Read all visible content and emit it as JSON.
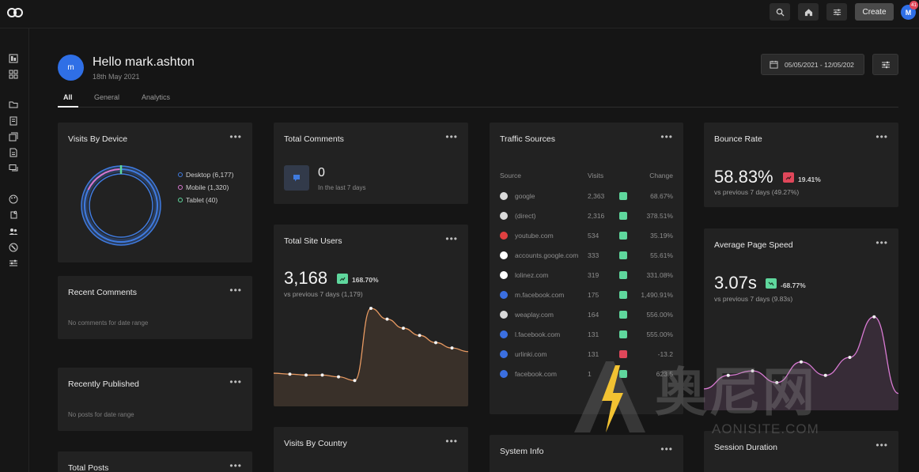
{
  "topbar": {
    "create_label": "Create",
    "avatar_initial": "M",
    "notification_count": "41"
  },
  "header": {
    "avatar_initial": "m",
    "greeting": "Hello mark.ashton",
    "date": "18th May 2021",
    "date_range": "05/05/2021 - 12/05/202"
  },
  "tabs": [
    {
      "label": "All",
      "active": true
    },
    {
      "label": "General",
      "active": false
    },
    {
      "label": "Analytics",
      "active": false
    }
  ],
  "visits_by_device": {
    "title": "Visits By Device",
    "legend": [
      {
        "label": "Desktop (6,177)",
        "color": "#3f7be0"
      },
      {
        "label": "Mobile (1,320)",
        "color": "#d977d0"
      },
      {
        "label": "Tablet (40)",
        "color": "#5fd79d"
      }
    ]
  },
  "recent_comments": {
    "title": "Recent Comments",
    "empty": "No comments for date range"
  },
  "recently_published": {
    "title": "Recently Published",
    "empty": "No posts for date range"
  },
  "total_posts": {
    "title": "Total Posts"
  },
  "total_comments": {
    "title": "Total Comments",
    "value": "0",
    "sub": "In the last 7 days"
  },
  "total_site_users": {
    "title": "Total Site Users",
    "value": "3,168",
    "change": "168.70%",
    "sub": "vs previous 7 days (1,179)",
    "line_color": "#e89a62",
    "series": [
      0.28,
      0.27,
      0.26,
      0.26,
      0.24,
      0.2,
      1.0,
      0.88,
      0.78,
      0.7,
      0.62,
      0.56,
      0.52
    ]
  },
  "visits_by_country": {
    "title": "Visits By Country"
  },
  "traffic_sources": {
    "title": "Traffic Sources",
    "headers": {
      "source": "Source",
      "visits": "Visits",
      "change": "Change"
    },
    "rows": [
      {
        "source": "google",
        "visits": "2,363",
        "change": "68.67%",
        "icon_color": "#d9d9d9",
        "up": true
      },
      {
        "source": "(direct)",
        "visits": "2,316",
        "change": "378.51%",
        "icon_color": "#d9d9d9",
        "up": true
      },
      {
        "source": "youtube.com",
        "visits": "534",
        "change": "35.19%",
        "icon_color": "#e04040",
        "up": true
      },
      {
        "source": "accounts.google.com",
        "visits": "333",
        "change": "55.61%",
        "icon_color": "#ffffff",
        "up": true
      },
      {
        "source": "lolinez.com",
        "visits": "319",
        "change": "331.08%",
        "icon_color": "#ffffff",
        "up": true
      },
      {
        "source": "m.facebook.com",
        "visits": "175",
        "change": "1,490.91%",
        "icon_color": "#3b6fe0",
        "up": true
      },
      {
        "source": "weaplay.com",
        "visits": "164",
        "change": "556.00%",
        "icon_color": "#d9d9d9",
        "up": true
      },
      {
        "source": "l.facebook.com",
        "visits": "131",
        "change": "555.00%",
        "icon_color": "#3b6fe0",
        "up": true
      },
      {
        "source": "urlinki.com",
        "visits": "131",
        "change": "-13.2",
        "icon_color": "#3b6fe0",
        "up": false
      },
      {
        "source": "facebook.com",
        "visits": "1",
        "change": "623.5",
        "icon_color": "#3b6fe0",
        "up": true
      }
    ]
  },
  "system_info": {
    "title": "System Info"
  },
  "bounce_rate": {
    "title": "Bounce Rate",
    "value": "58.83%",
    "change": "19.41%",
    "sub": "vs previous 7 days (49.27%)"
  },
  "average_page_speed": {
    "title": "Average Page Speed",
    "value": "3.07s",
    "change": "-68.77%",
    "sub": "vs previous 7 days (9.83s)",
    "line_color": "#d87ad2",
    "series": [
      0.15,
      0.3,
      0.35,
      0.22,
      0.45,
      0.3,
      0.5,
      0.95,
      0.1
    ]
  },
  "session_duration": {
    "title": "Session Duration"
  },
  "watermark": {
    "cn": "奥尼网",
    "en": "AONISITE.COM"
  },
  "colors": {
    "accent_blue": "#2f6fe6",
    "positive": "#5fd79d",
    "negative": "#e0475a"
  }
}
